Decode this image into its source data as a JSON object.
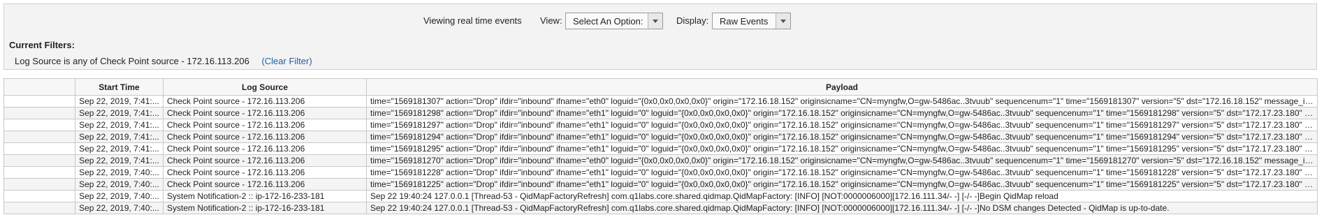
{
  "toolbar": {
    "viewing_text": "Viewing real time events",
    "view_label": "View:",
    "view_select_value": "Select An Option:",
    "display_label": "Display:",
    "display_select_value": "Raw Events"
  },
  "filters": {
    "title": "Current Filters:",
    "filter_text": "Log Source is any of Check Point source - 172.16.113.206",
    "clear_label": "(Clear Filter)"
  },
  "table": {
    "columns": [
      "",
      "Start Time",
      "Log Source",
      "Payload"
    ],
    "rows": [
      {
        "time": "Sep 22, 2019, 7:41:...",
        "source": "Check Point source - 172.16.113.206",
        "payload": "time=\"1569181307\" action=\"Drop\" ifdir=\"inbound\" ifname=\"eth0\" loguid=\"{0x0,0x0,0x0,0x0}\" origin=\"172.16.18.152\" originsicname=\"CN=myngfw,O=gw-5486ac..3tvuub\" sequencenum=\"1\" time=\"1569181307\" version=\"5\" dst=\"172.16.18.152\" message_in..."
      },
      {
        "time": "Sep 22, 2019, 7:41:...",
        "source": "Check Point source - 172.16.113.206",
        "payload": "time=\"1569181298\" action=\"Drop\" ifdir=\"inbound\" ifname=\"eth1\" loguid=\"0\" loguid=\"{0x0,0x0,0x0,0x0}\" origin=\"172.16.18.152\" originsicname=\"CN=myngfw,O=gw-5486ac..3tvuub\" sequencenum=\"1\" time=\"1569181298\" version=\"5\" dst=\"172.17.23.180\" la..."
      },
      {
        "time": "Sep 22, 2019, 7:41:...",
        "source": "Check Point source - 172.16.113.206",
        "payload": "time=\"1569181297\" action=\"Drop\" ifdir=\"inbound\" ifname=\"eth1\" loguid=\"0\" loguid=\"{0x0,0x0,0x0,0x0}\" origin=\"172.16.18.152\" originsicname=\"CN=myngfw,O=gw-5486ac..3tvuub\" sequencenum=\"1\" time=\"1569181297\" version=\"5\" dst=\"172.17.23.180\" la..."
      },
      {
        "time": "Sep 22, 2019, 7:41:...",
        "source": "Check Point source - 172.16.113.206",
        "payload": "time=\"1569181294\" action=\"Drop\" ifdir=\"inbound\" ifname=\"eth1\" loguid=\"0\" loguid=\"{0x0,0x0,0x0,0x0}\" origin=\"172.16.18.152\" originsicname=\"CN=myngfw,O=gw-5486ac..3tvuub\" sequencenum=\"1\" time=\"1569181294\" version=\"5\" dst=\"172.17.23.180\" la..."
      },
      {
        "time": "Sep 22, 2019, 7:41:...",
        "source": "Check Point source - 172.16.113.206",
        "payload": "time=\"1569181295\" action=\"Drop\" ifdir=\"inbound\" ifname=\"eth1\" loguid=\"0\" loguid=\"{0x0,0x0,0x0,0x0}\" origin=\"172.16.18.152\" originsicname=\"CN=myngfw,O=gw-5486ac..3tvuub\" sequencenum=\"1\" time=\"1569181295\" version=\"5\" dst=\"172.17.23.180\" la..."
      },
      {
        "time": "Sep 22, 2019, 7:41:...",
        "source": "Check Point source - 172.16.113.206",
        "payload": "time=\"1569181270\" action=\"Drop\" ifdir=\"inbound\" ifname=\"eth0\" loguid=\"{0x0,0x0,0x0,0x0}\" origin=\"172.16.18.152\" originsicname=\"CN=myngfw,O=gw-5486ac..3tvuub\" sequencenum=\"1\" time=\"1569181270\" version=\"5\" dst=\"172.16.18.152\" message_in..."
      },
      {
        "time": "Sep 22, 2019, 7:40:...",
        "source": "Check Point source - 172.16.113.206",
        "payload": "time=\"1569181228\" action=\"Drop\" ifdir=\"inbound\" ifname=\"eth1\" loguid=\"0\" loguid=\"{0x0,0x0,0x0,0x0}\" origin=\"172.16.18.152\" originsicname=\"CN=myngfw,O=gw-5486ac..3tvuub\" sequencenum=\"1\" time=\"1569181228\" version=\"5\" dst=\"172.17.23.180\" la..."
      },
      {
        "time": "Sep 22, 2019, 7:40:...",
        "source": "Check Point source - 172.16.113.206",
        "payload": "time=\"1569181225\" action=\"Drop\" ifdir=\"inbound\" ifname=\"eth1\" loguid=\"0\" loguid=\"{0x0,0x0,0x0,0x0}\" origin=\"172.16.18.152\" originsicname=\"CN=myngfw,O=gw-5486ac..3tvuub\" sequencenum=\"1\" time=\"1569181225\" version=\"5\" dst=\"172.17.23.180\" la..."
      },
      {
        "time": "Sep 22, 2019, 7:40:...",
        "source": "System Notification-2 :: ip-172-16-233-181",
        "payload": "Sep 22 19:40:24 127.0.0.1  [Thread-53 - QidMapFactoryRefresh] com.q1labs.core.shared.qidmap.QidMapFactory: [INFO] [NOT:0000006000][172.16.111.34/- -] [-/- -]Begin QidMap reload"
      },
      {
        "time": "Sep 22, 2019, 7:40:...",
        "source": "System Notification-2 :: ip-172-16-233-181",
        "payload": "Sep 22 19:40:24 127.0.0.1  [Thread-53 - QidMapFactoryRefresh] com.q1labs.core.shared.qidmap.QidMapFactory: [INFO] [NOT:0000006000][172.16.111.34/- -] [-/- -]No DSM changes Detected - QidMap is up-to-date."
      }
    ]
  }
}
